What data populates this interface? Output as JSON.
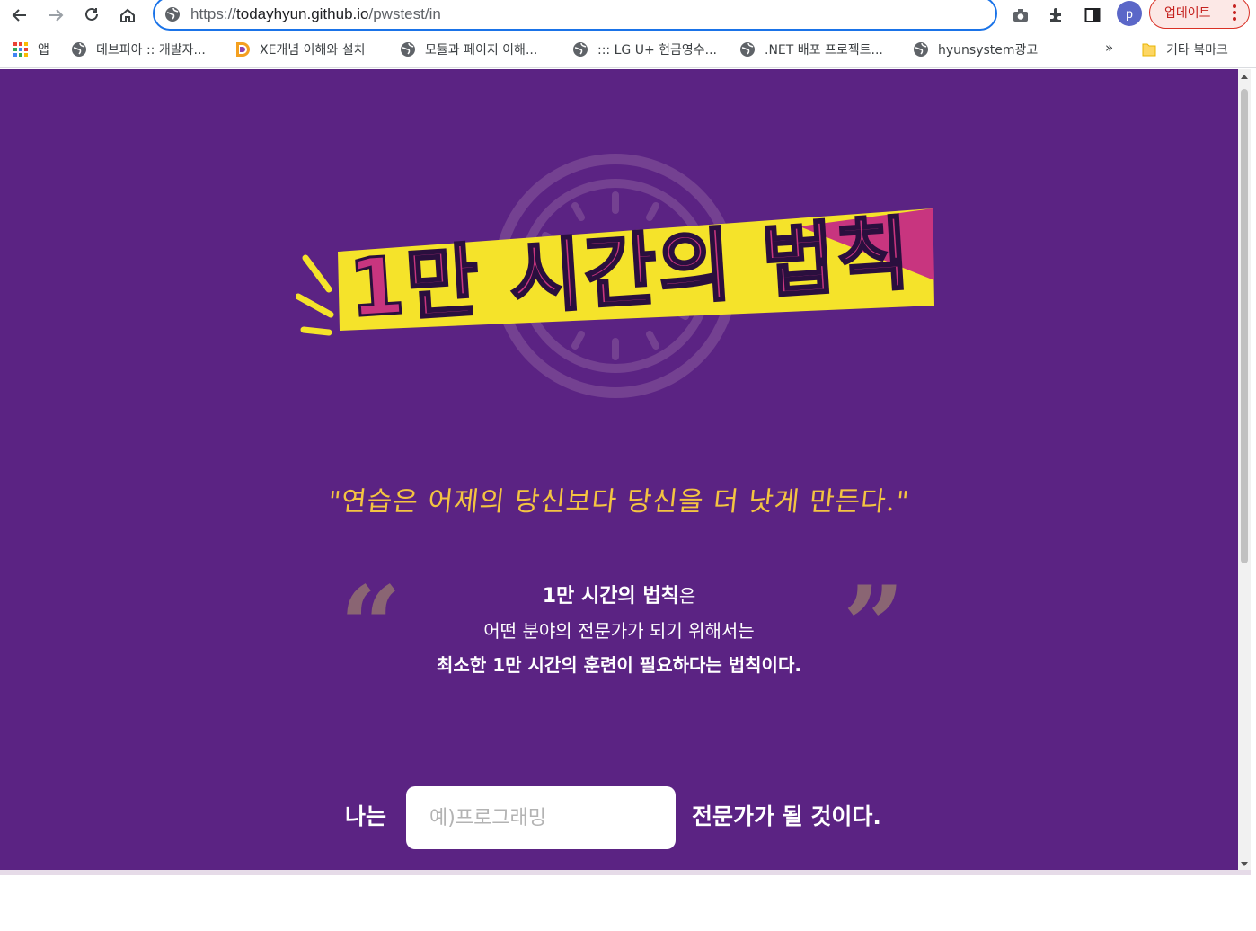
{
  "browser": {
    "url_scheme": "https://",
    "url_host": "todayhyun.github.io",
    "url_path": "/pwstest/in",
    "profile_initial": "p",
    "update_label": "업데이트"
  },
  "bookmarks": {
    "items": [
      {
        "label": "앱",
        "icon": "apps-grid-icon"
      },
      {
        "label": "데브피아 :: 개발자...",
        "icon": "globe-icon"
      },
      {
        "label": "XE개념 이해와 설치",
        "icon": "d-logo-icon"
      },
      {
        "label": "모듈과 페이지 이해...",
        "icon": "globe-icon"
      },
      {
        "label": "::: LG U+ 현금영수...",
        "icon": "globe-icon"
      },
      {
        "label": ".NET 배포 프로젝트...",
        "icon": "globe-icon"
      },
      {
        "label": "hyunsystem광고",
        "icon": "globe-icon"
      }
    ],
    "more": "»",
    "other_label": "기타 북마크"
  },
  "page": {
    "hero_title": "1만 시간의 법칙",
    "tagline": "\"연습은 어제의 당신보다 당신을 더 낫게 만든다.\"",
    "quote_open": "“",
    "quote_close": "”",
    "desc_title": "1만 시간의 법칙",
    "desc_title_suffix": "은",
    "desc_line2": "어떤 분야의 전문가가 되기 위해서는",
    "desc_line3": "최소한 1만 시간의 훈련이 필요하다는 법칙이다.",
    "form_prefix": "나는",
    "field_placeholder": "예)프로그래밍",
    "field_value": "",
    "form_suffix": "전문가가 될 것이다."
  },
  "colors": {
    "page_bg": "#5b2383",
    "banner_yellow": "#f5e32a",
    "accent_pink": "#c8357f",
    "tagline_yellow": "#f4c441",
    "accent_blue": "#1a73e8",
    "update_red": "#d93025"
  }
}
